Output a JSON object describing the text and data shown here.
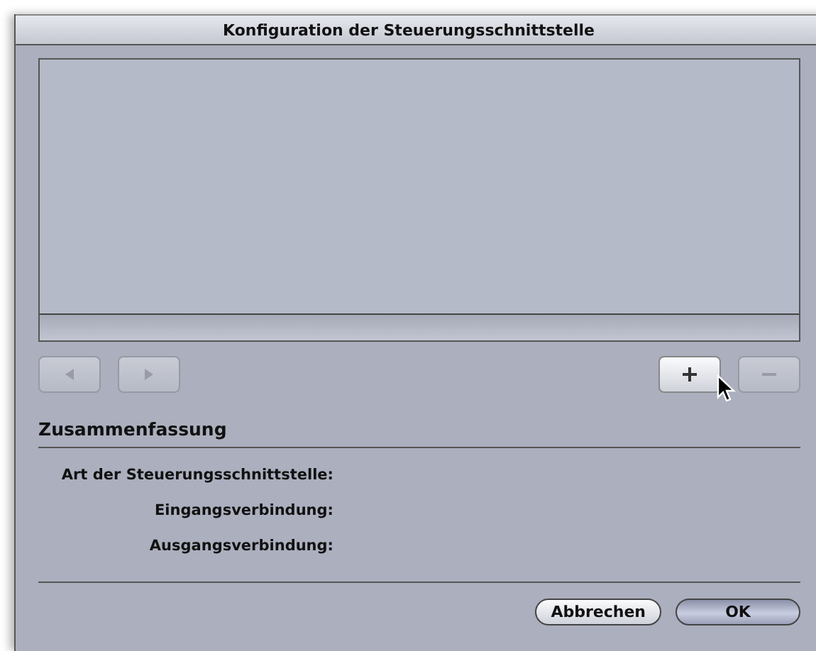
{
  "window": {
    "title": "Konfiguration der Steuerungsschnittstelle"
  },
  "list_buttons": [
    {
      "kind": "previous",
      "disabled": true
    },
    {
      "kind": "next",
      "disabled": true
    },
    {
      "kind": "add",
      "disabled": false
    },
    {
      "kind": "remove",
      "disabled": true
    }
  ],
  "summary": {
    "heading": "Zusammenfassung",
    "fields": [
      {
        "label": "Art der Steuerungsschnittstelle:"
      },
      {
        "label": "Eingangsverbindung:"
      },
      {
        "label": "Ausgangsverbindung:"
      }
    ]
  },
  "buttons": [
    {
      "label": "Abbrechen",
      "default": false
    },
    {
      "label": "OK",
      "default": true
    }
  ]
}
